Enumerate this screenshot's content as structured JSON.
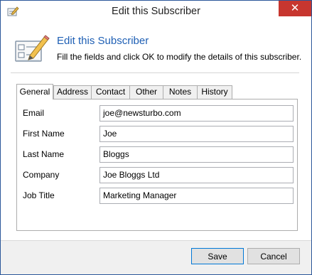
{
  "window": {
    "title": "Edit this Subscriber",
    "close_glyph": "✕"
  },
  "header": {
    "title": "Edit this Subscriber",
    "description": "Fill the fields and click OK to modify the details of this subscriber.",
    "icon": "edit-form-icon",
    "title_color": "#1e5fb4"
  },
  "tabs": [
    {
      "label": "General",
      "active": true
    },
    {
      "label": "Address",
      "active": false
    },
    {
      "label": "Contact",
      "active": false
    },
    {
      "label": "Other",
      "active": false
    },
    {
      "label": "Notes",
      "active": false
    },
    {
      "label": "History",
      "active": false
    }
  ],
  "fields": [
    {
      "label": "Email",
      "value": "joe@newsturbo.com"
    },
    {
      "label": "First Name",
      "value": "Joe"
    },
    {
      "label": "Last Name",
      "value": "Bloggs"
    },
    {
      "label": "Company",
      "value": "Joe Bloggs Ltd"
    },
    {
      "label": "Job Title",
      "value": "Marketing Manager"
    }
  ],
  "buttons": {
    "save": "Save",
    "cancel": "Cancel"
  },
  "colors": {
    "close_button": "#c7362f",
    "window_border": "#2b579a"
  }
}
